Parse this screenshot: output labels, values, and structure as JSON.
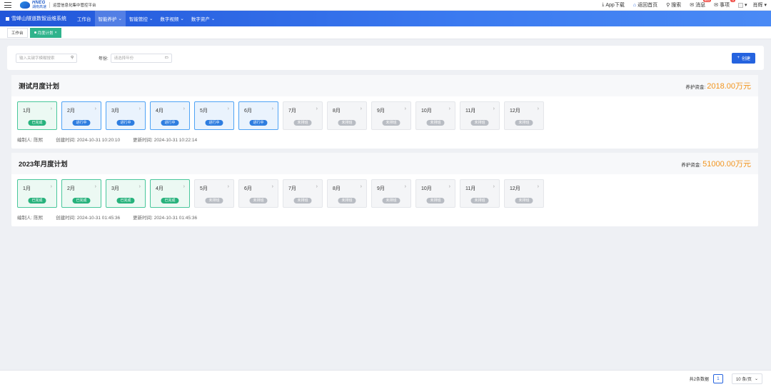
{
  "topbar": {
    "logo_en": "HNEG",
    "logo_cn": "湖南高速",
    "platform": "运营信息化集中管控平台",
    "app_download": "App下载",
    "home": "返回首页",
    "search": "搜索",
    "message": "消息",
    "message_badge": "653",
    "todo": "事项",
    "todo_badge": "0",
    "user": "肖辉"
  },
  "nav": {
    "system": "雪峰山隧道数智运维系统",
    "items": [
      "工作台",
      "智能养护",
      "智能管控",
      "数字视频",
      "数字资产"
    ]
  },
  "tabs": [
    "工作台",
    "月度计划"
  ],
  "filter": {
    "search_placeholder": "输入关键字模糊搜索",
    "year_label": "年份:",
    "year_placeholder": "请选择年份",
    "create_label": "创建"
  },
  "plans": [
    {
      "title": "测试月度计划",
      "fund_label": "养护资金:",
      "fund_value": "2018.00万元",
      "months": [
        {
          "label": "1月",
          "status": "已完成",
          "state": "done"
        },
        {
          "label": "2月",
          "status": "进行中",
          "state": "progress"
        },
        {
          "label": "3月",
          "status": "进行中",
          "state": "progress"
        },
        {
          "label": "4月",
          "status": "进行中",
          "state": "progress"
        },
        {
          "label": "5月",
          "status": "进行中",
          "state": "progress"
        },
        {
          "label": "6月",
          "status": "进行中",
          "state": "progress"
        },
        {
          "label": "7月",
          "status": "未排班",
          "state": "pending"
        },
        {
          "label": "8月",
          "status": "未排班",
          "state": "pending"
        },
        {
          "label": "9月",
          "status": "未排班",
          "state": "pending"
        },
        {
          "label": "10月",
          "status": "未排班",
          "state": "pending"
        },
        {
          "label": "11月",
          "status": "未排班",
          "state": "pending"
        },
        {
          "label": "12月",
          "status": "未排班",
          "state": "pending"
        }
      ],
      "editor": "编制人: 陈熙",
      "created": "创建时间: 2024-10-31 10:20:10",
      "updated": "更新时间: 2024-10-31 10:22:14"
    },
    {
      "title": "2023年月度计划",
      "fund_label": "养护资金:",
      "fund_value": "51000.00万元",
      "months": [
        {
          "label": "1月",
          "status": "已完成",
          "state": "done"
        },
        {
          "label": "2月",
          "status": "已完成",
          "state": "done"
        },
        {
          "label": "3月",
          "status": "已完成",
          "state": "done"
        },
        {
          "label": "4月",
          "status": "已完成",
          "state": "done"
        },
        {
          "label": "5月",
          "status": "未排班",
          "state": "pending"
        },
        {
          "label": "6月",
          "status": "未排班",
          "state": "pending"
        },
        {
          "label": "7月",
          "status": "未排班",
          "state": "pending"
        },
        {
          "label": "8月",
          "status": "未排班",
          "state": "pending"
        },
        {
          "label": "9月",
          "status": "未排班",
          "state": "pending"
        },
        {
          "label": "10月",
          "status": "未排班",
          "state": "pending"
        },
        {
          "label": "11月",
          "status": "未排班",
          "state": "pending"
        },
        {
          "label": "12月",
          "status": "未排班",
          "state": "pending"
        }
      ],
      "editor": "编制人: 陈熙",
      "created": "创建时间: 2024-10-31 01:45:36",
      "updated": "更新时间: 2024-10-31 01:45:36"
    }
  ],
  "pagination": {
    "total": "共2条数据",
    "current_page": "1",
    "page_size": "10 条/页"
  },
  "colors": {
    "primary": "#2563df",
    "done": "#27b27c",
    "progress": "#2e7de0",
    "pending": "#b8bcc3",
    "fund": "#f2941d"
  }
}
